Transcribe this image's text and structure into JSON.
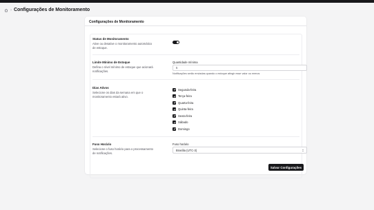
{
  "page": {
    "title": "Configurações de Monitoramento"
  },
  "card": {
    "title": "Configurações de Monitoramento"
  },
  "monitoring": {
    "title": "Status de Monitoramento",
    "description": "Ative ou desative o monitoramento automático de estoque.",
    "enabled": true
  },
  "stock": {
    "title": "Limite Mínimo de Estoque",
    "description": "Defina o nível mínimo de estoque que acionará notificações.",
    "field_label": "Quantidade mínima",
    "value": "5",
    "help": "Notificações serão enviadas quando o estoque atingir esse valor ou menos"
  },
  "days": {
    "title": "Dias Ativos",
    "description": "Selecione os dias da semana em que o monitoramento estará ativo.",
    "items": [
      {
        "label": "Segunda-feira",
        "checked": true
      },
      {
        "label": "Terça-feira",
        "checked": true
      },
      {
        "label": "Quarta-feira",
        "checked": true
      },
      {
        "label": "Quinta-feira",
        "checked": true
      },
      {
        "label": "Sexta-feira",
        "checked": true
      },
      {
        "label": "Sábado",
        "checked": true
      },
      {
        "label": "Domingo",
        "checked": true
      }
    ]
  },
  "timezone": {
    "title": "Fuso Horário",
    "description": "Selecione o fuso horário para o processamento de notificações.",
    "field_label": "Fuso horário",
    "selected": "Brasília (UTC-3)"
  },
  "actions": {
    "save_label": "Salvar Configurações"
  },
  "icons": {
    "home": "home-icon",
    "breadcrumb_separator": "chevron-right-icon",
    "checkbox_check": "check-icon",
    "select": "chevron-up-down-icon"
  },
  "colors": {
    "accent": "#18181b",
    "background": "#f4f4f5",
    "card": "#ffffff",
    "muted_text": "#52525b"
  }
}
